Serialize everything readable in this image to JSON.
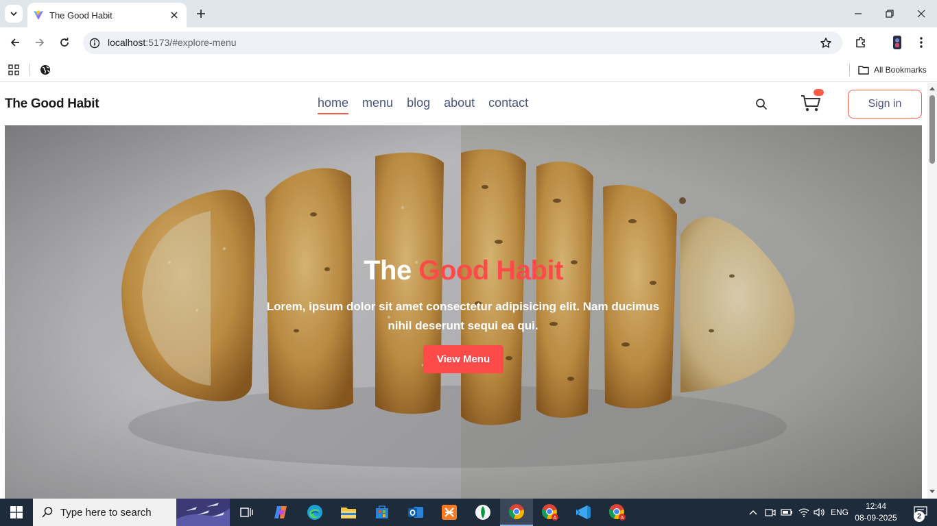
{
  "browser": {
    "tab_title": "The Good Habit",
    "url_host": "localhost",
    "url_path": ":5173/#explore-menu",
    "all_bookmarks_label": "All Bookmarks"
  },
  "site": {
    "logo": "The Good Habit",
    "nav": [
      {
        "label": "home",
        "active": true
      },
      {
        "label": "menu",
        "active": false
      },
      {
        "label": "blog",
        "active": false
      },
      {
        "label": "about",
        "active": false
      },
      {
        "label": "contact",
        "active": false
      }
    ],
    "signin_label": "Sign in",
    "accent_color": "#ff4a4a",
    "nav_text_color": "#49557e"
  },
  "hero": {
    "title_prefix": "The",
    "title_accent": "Good Habit",
    "text": "Lorem, ipsum dolor sit amet consectetur adipisicing elit. Nam ducimus nihil deserunt sequi ea qui.",
    "button_label": "View Menu",
    "image": "sliced-bread-loaf"
  },
  "taskbar": {
    "search_placeholder": "Type here to search",
    "language": "ENG",
    "time": "12:44",
    "date": "08-09-2025",
    "notification_count": "2",
    "apps": [
      "task-view",
      "copilot",
      "edge",
      "file-explorer",
      "microsoft-store",
      "outlook",
      "xampp",
      "mongodb-compass",
      "chrome",
      "chrome",
      "vscode",
      "chrome"
    ]
  }
}
